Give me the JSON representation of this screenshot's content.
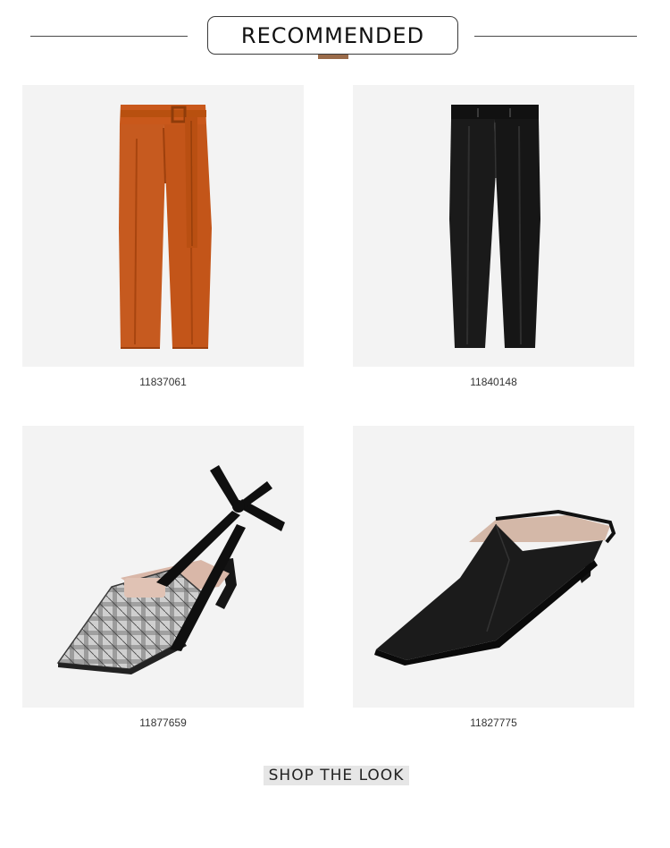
{
  "header": {
    "title": "RECOMMENDED",
    "accent_color": "#9a6b4a"
  },
  "products": [
    {
      "sku": "11837061",
      "image": "orange-belted-trousers",
      "color": "#c85a1e"
    },
    {
      "sku": "11840148",
      "image": "black-trousers",
      "color": "#151515"
    },
    {
      "sku": "11877659",
      "image": "plaid-slingback-bow-heel",
      "color": "#8a8a8a"
    },
    {
      "sku": "11827775",
      "image": "black-pointed-mule",
      "color": "#1b1b1b"
    }
  ],
  "footer": {
    "button_label": "SHOP THE LOOK"
  }
}
